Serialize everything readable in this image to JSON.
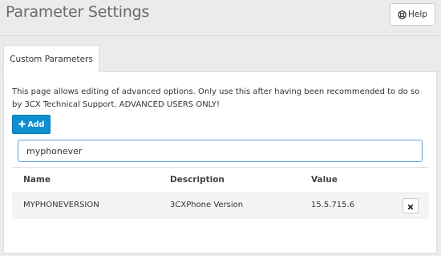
{
  "header": {
    "title": "Parameter Settings",
    "help_label": "Help"
  },
  "tabs": [
    {
      "label": "Custom Parameters",
      "active": true
    }
  ],
  "main": {
    "description": "This page allows editing of advanced options. Only use this after having been recommended to do so by 3CX Technical Support. ADVANCED USERS ONLY!",
    "add_label": "Add",
    "search_value": "myphonever",
    "table": {
      "columns": [
        "Name",
        "Description",
        "Value"
      ],
      "rows": [
        {
          "name": "MYPHONEVERSION",
          "description": "3CXPhone Version",
          "value": "15.5.715.6"
        }
      ]
    }
  },
  "colors": {
    "accent": "#0f8fd0",
    "background": "#ebebeb"
  }
}
